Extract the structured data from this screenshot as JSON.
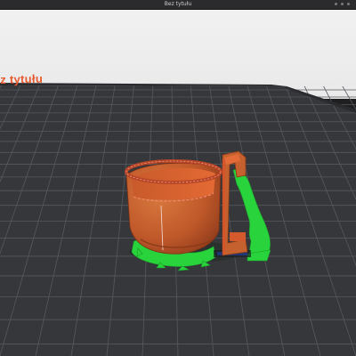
{
  "window": {
    "title": "Bez tytułu"
  },
  "viewport": {
    "bed_label": "z tytułu"
  },
  "colors": {
    "bed_surface": "#34363a",
    "bed_grid": "#55585d",
    "bed_label": "#e8592f",
    "model_body": "#c4612e",
    "model_wall": "#d4552c",
    "support": "#27d33a",
    "background": "#1f1f21"
  }
}
